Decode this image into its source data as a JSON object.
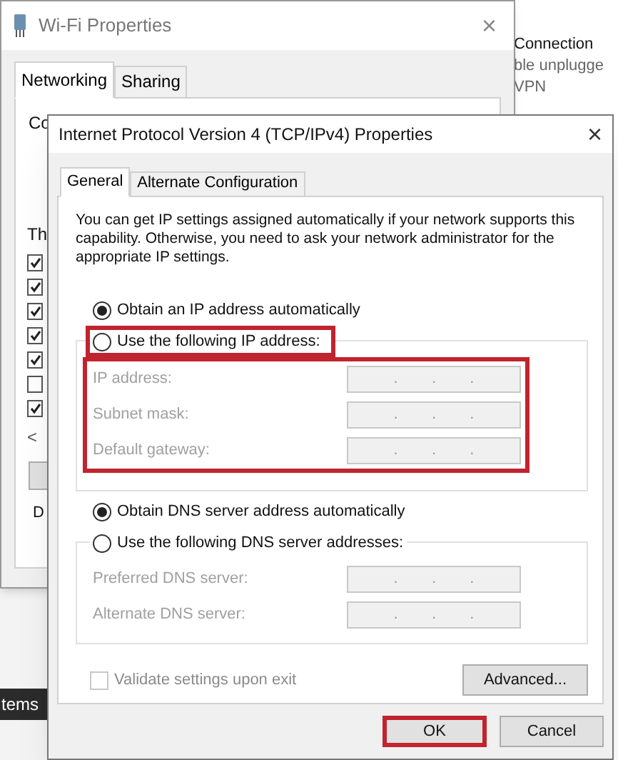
{
  "background_window": {
    "title": "Wi-Fi Properties",
    "close": "×",
    "tabs": [
      {
        "label": "Networking",
        "selected": true
      },
      {
        "label": "Sharing",
        "selected": false
      }
    ],
    "label_1": "Co",
    "label_2": "Th",
    "label_3": "D",
    "list_scroll": "<",
    "checkboxes": [
      {
        "checked": true
      },
      {
        "checked": true
      },
      {
        "checked": true
      },
      {
        "checked": true
      },
      {
        "checked": true
      },
      {
        "checked": false
      },
      {
        "checked": true
      }
    ]
  },
  "side_panel": {
    "lines": [
      "Connection",
      "ble unplugge",
      "VPN"
    ]
  },
  "taskbar_label": "tems",
  "dialog": {
    "title": "Internet Protocol Version 4 (TCP/IPv4) Properties",
    "close": "×",
    "tabs": [
      {
        "label": "General",
        "selected": true
      },
      {
        "label": "Alternate Configuration",
        "selected": false
      }
    ],
    "description": "You can get IP settings assigned automatically if your network supports this capability. Otherwise, you need to ask your network administrator for the appropriate IP settings.",
    "ip_options": [
      {
        "label": "Obtain an IP address automatically",
        "selected": true,
        "highlighted": false
      },
      {
        "label": "Use the following IP address:",
        "selected": false,
        "highlighted": true
      }
    ],
    "ip_fields": {
      "disabled": true,
      "highlighted": true,
      "fields": [
        {
          "label": "IP address:",
          "separators": [
            ".",
            ".",
            "."
          ]
        },
        {
          "label": "Subnet mask:",
          "separators": [
            ".",
            ".",
            "."
          ]
        },
        {
          "label": "Default gateway:",
          "separators": [
            ".",
            ".",
            "."
          ]
        }
      ]
    },
    "dns_options": [
      {
        "label": "Obtain DNS server address automatically",
        "selected": true,
        "highlighted": false
      },
      {
        "label": "Use the following DNS server addresses:",
        "selected": false,
        "highlighted": false
      }
    ],
    "dns_fields": {
      "disabled": true,
      "highlighted": false,
      "fields": [
        {
          "label": "Preferred DNS server:",
          "separators": [
            ".",
            ".",
            "."
          ]
        },
        {
          "label": "Alternate DNS server:",
          "separators": [
            ".",
            ".",
            "."
          ]
        }
      ]
    },
    "validate": {
      "label": "Validate settings upon exit",
      "checked": false,
      "disabled": true
    },
    "advanced_button": "Advanced...",
    "buttons": [
      {
        "label": "OK",
        "highlighted": true
      },
      {
        "label": "Cancel",
        "highlighted": false
      }
    ]
  }
}
